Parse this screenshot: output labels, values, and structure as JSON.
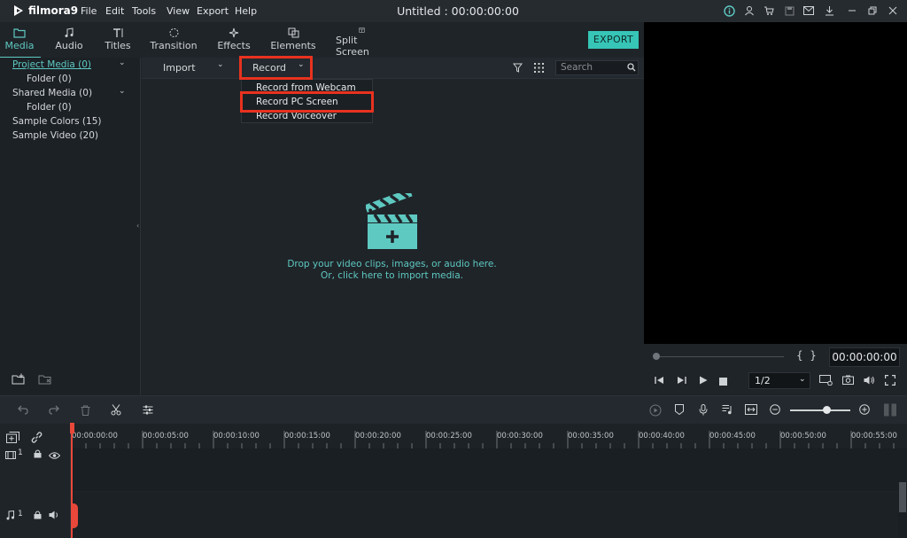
{
  "app": {
    "logo_text": "filmora9",
    "window_title": "Untitled : 00:00:00:00"
  },
  "menu": [
    "File",
    "Edit",
    "Tools",
    "View",
    "Export",
    "Help"
  ],
  "tabs": [
    {
      "label": "Media",
      "icon": "folder-icon",
      "active": true
    },
    {
      "label": "Audio",
      "icon": "music-note-icon",
      "active": false
    },
    {
      "label": "Titles",
      "icon": "titles-icon",
      "active": false
    },
    {
      "label": "Transition",
      "icon": "transition-icon",
      "active": false
    },
    {
      "label": "Effects",
      "icon": "effects-icon",
      "active": false
    },
    {
      "label": "Elements",
      "icon": "elements-icon",
      "active": false
    },
    {
      "label": "Split Screen",
      "icon": "split-screen-icon",
      "active": false
    }
  ],
  "export_label": "EXPORT",
  "sidebar": {
    "items": [
      {
        "label": "Project Media (0)",
        "active": true
      },
      {
        "label": "Folder (0)"
      },
      {
        "label": "Shared Media (0)"
      },
      {
        "label": "Folder (0)"
      },
      {
        "label": "Sample Colors (15)"
      },
      {
        "label": "Sample Video (20)"
      }
    ]
  },
  "media_toolbar": {
    "import_label": "Import",
    "record_label": "Record",
    "search_placeholder": "Search"
  },
  "record_menu": {
    "items": [
      "Record from Webcam",
      "Record PC Screen",
      "Record Voiceover"
    ],
    "highlighted": "Record PC Screen"
  },
  "drop_hint": {
    "line1": "Drop your video clips, images, or audio here.",
    "line2": "Or, click here to import media."
  },
  "preview": {
    "timecode": "00:00:00:00",
    "ratio": "1/2",
    "brackets": "{  }"
  },
  "timeline": {
    "ticks": [
      "00:00:00:00",
      "00:00:05:00",
      "00:00:10:00",
      "00:00:15:00",
      "00:00:20:00",
      "00:00:25:00",
      "00:00:30:00",
      "00:00:35:00",
      "00:00:40:00",
      "00:00:45:00",
      "00:00:50:00",
      "00:00:55:00"
    ],
    "video_track_label": "1",
    "audio_track_label": "1"
  },
  "colors": {
    "accent": "#5ec9c1",
    "export_button": "#36c5b6",
    "highlight_box": "#e8321f",
    "playhead": "#e8483a"
  }
}
